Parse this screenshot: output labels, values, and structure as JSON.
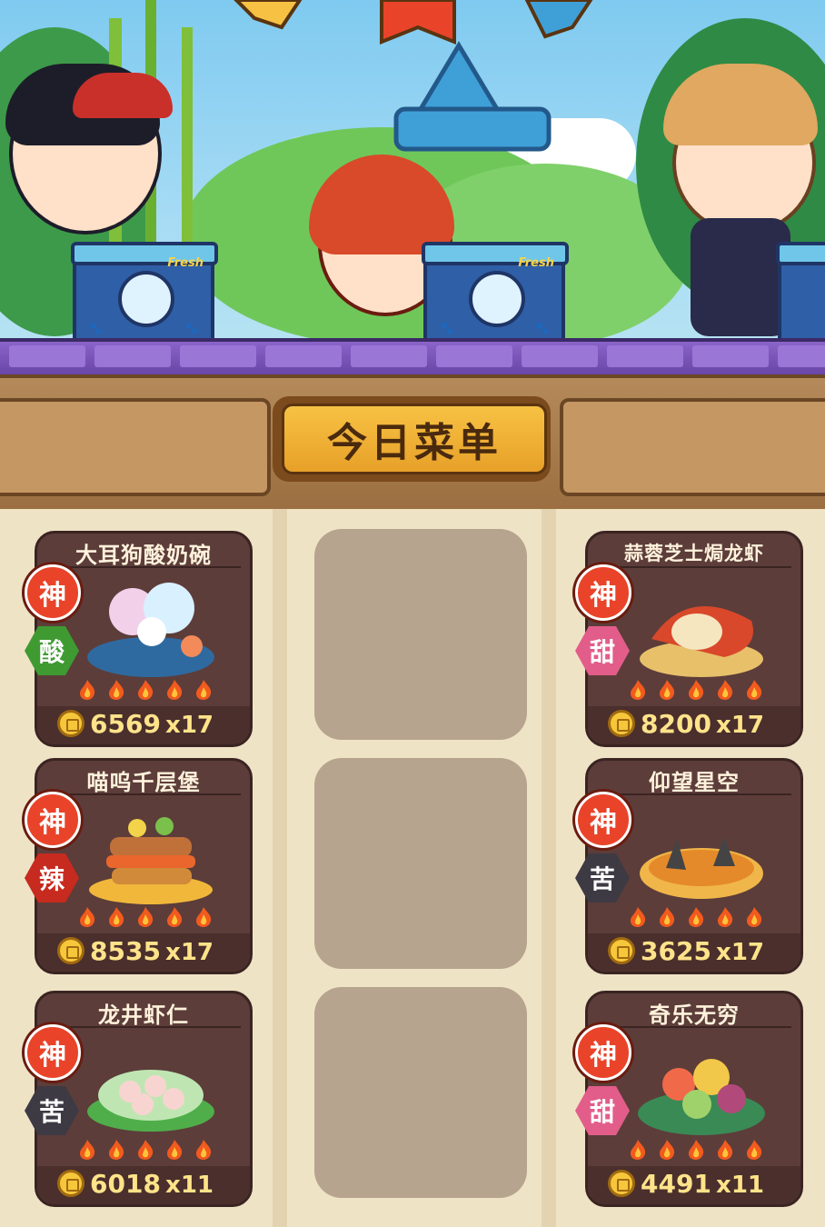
{
  "header": {
    "menu_title": "今日菜单"
  },
  "scene": {
    "box_label": "Fresh"
  },
  "colors": {
    "flavor_sour": "#3f9a32",
    "flavor_sweet": "#e25d8a",
    "flavor_spicy": "#c72a1e",
    "flavor_bitter": "#3e3a44",
    "rank_red": "#e9442a",
    "price_gold": "#ffe38a"
  },
  "dishes": [
    {
      "name": "大耳狗酸奶碗",
      "rank": "神",
      "flavor": "酸",
      "flavor_color": "sour",
      "flames": 5,
      "price": "6569",
      "qty": "x17"
    },
    {
      "name": "蒜蓉芝士焗龙虾",
      "rank": "神",
      "flavor": "甜",
      "flavor_color": "sweet",
      "flames": 5,
      "price": "8200",
      "qty": "x17"
    },
    {
      "name": "喵呜千层堡",
      "rank": "神",
      "flavor": "辣",
      "flavor_color": "spicy",
      "flames": 5,
      "price": "8535",
      "qty": "x17"
    },
    {
      "name": "仰望星空",
      "rank": "神",
      "flavor": "苦",
      "flavor_color": "bitter",
      "flames": 5,
      "price": "3625",
      "qty": "x17"
    },
    {
      "name": "龙井虾仁",
      "rank": "神",
      "flavor": "苦",
      "flavor_color": "bitter",
      "flames": 5,
      "price": "6018",
      "qty": "x11"
    },
    {
      "name": "奇乐无穷",
      "rank": "神",
      "flavor": "甜",
      "flavor_color": "sweet",
      "flames": 5,
      "price": "4491",
      "qty": "x11"
    }
  ],
  "empty_slots": 3
}
